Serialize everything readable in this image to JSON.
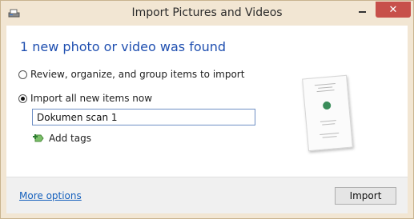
{
  "window": {
    "title": "Import Pictures and Videos",
    "close_glyph": "✕",
    "icon": "scanner-icon",
    "colors": {
      "frame": "#f2e6d3",
      "close": "#c7504a",
      "heading": "#1f4fb0",
      "link": "#1560bd"
    }
  },
  "main": {
    "heading": "1 new photo or video was found",
    "options": [
      {
        "label": "Review, organize, and group items to import",
        "selected": false
      },
      {
        "label": "Import all new items now",
        "selected": true
      }
    ],
    "name_field": {
      "value": "Dokumen scan 1"
    },
    "add_tags": {
      "label": "Add tags",
      "icon": "add-tag-icon"
    },
    "preview": {
      "icon": "document-thumbnail"
    }
  },
  "footer": {
    "more_options_label": "More options",
    "import_label": "Import"
  }
}
